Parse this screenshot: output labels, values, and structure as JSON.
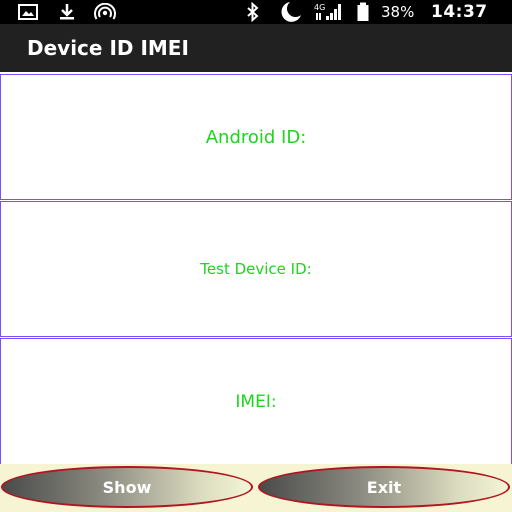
{
  "status_bar": {
    "icons_left": [
      "image-icon",
      "download-icon",
      "hotspot-icon"
    ],
    "icons_right": [
      "bluetooth-icon",
      "moon-icon",
      "signal-icon",
      "battery-icon"
    ],
    "network_label": "4G",
    "battery_percent": "38%",
    "time": "14:37"
  },
  "app_bar": {
    "title": "Device ID IMEI"
  },
  "panels": [
    {
      "label": "Android ID:"
    },
    {
      "label": "Test Device ID:"
    },
    {
      "label": "IMEI:"
    }
  ],
  "buttons": {
    "show": "Show",
    "exit": "Exit"
  },
  "colors": {
    "label_green": "#1ed41e",
    "panel_border": "#7c4dff",
    "button_border": "#b0161f",
    "app_bar": "#212121"
  }
}
